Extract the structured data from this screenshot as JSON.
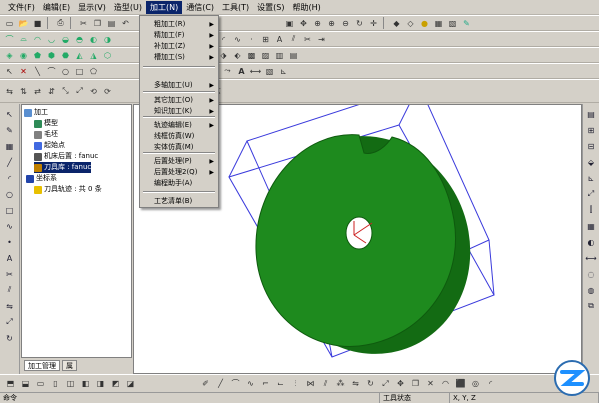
{
  "menubar": {
    "items": [
      {
        "label": "文件(F)"
      },
      {
        "label": "编辑(E)"
      },
      {
        "label": "显示(V)"
      },
      {
        "label": "造型(U)"
      },
      {
        "label": "加工(N)"
      },
      {
        "label": "通信(C)"
      },
      {
        "label": "工具(T)"
      },
      {
        "label": "设置(S)"
      },
      {
        "label": "帮助(H)"
      }
    ],
    "active_index": 4
  },
  "processing_menu": {
    "items": [
      {
        "label": "粗加工(R)",
        "submenu": true
      },
      {
        "label": "精加工(F)",
        "submenu": true
      },
      {
        "label": "补加工(Z)",
        "submenu": true
      },
      {
        "label": "槽加工(S)",
        "submenu": true
      },
      {
        "label": "多轴加工(U)",
        "submenu": true
      },
      {
        "label": "其它加工(O)",
        "submenu": true
      },
      {
        "label": "知识加工(K)",
        "submenu": true
      },
      {
        "label": "轨迹编辑(E)",
        "submenu": true
      },
      {
        "label": "线框仿真(W)",
        "submenu": false
      },
      {
        "label": "实体仿真(M)",
        "submenu": false
      },
      {
        "label": "后置处理(P)",
        "submenu": true
      },
      {
        "label": "后置处理2(Q)",
        "submenu": true
      },
      {
        "label": "编程助手(A)",
        "submenu": false
      },
      {
        "label": "工艺清单(B)",
        "submenu": false
      }
    ]
  },
  "tree": {
    "root": "加工",
    "nodes": [
      {
        "label": "模型",
        "icon": "model-icon",
        "color": "#2e8b57"
      },
      {
        "label": "毛坯",
        "icon": "blank-icon",
        "color": "#808080"
      },
      {
        "label": "起始点",
        "icon": "start-point-icon",
        "color": "#4169e1"
      },
      {
        "label": "机床后置 : fanuc",
        "icon": "machine-icon",
        "color": "#555555"
      },
      {
        "label": "刀具库 : fanuc",
        "icon": "tool-library-icon",
        "color": "#c08000",
        "selected": true
      },
      {
        "label": "坐标系",
        "icon": "coordinate-icon",
        "color": "#2244aa"
      },
      {
        "label": "刀具轨迹 : 共 0 条",
        "icon": "folder-icon",
        "color": "#e8c000"
      }
    ]
  },
  "panel_tabs": [
    {
      "label": "加工管理"
    },
    {
      "label": "属"
    }
  ],
  "status": {
    "command": "命令",
    "tool_status": "工具状态",
    "coords": "X, Y, Z"
  },
  "colors": {
    "part_green": "#1e8a1e",
    "menu_highlight": "#0a246a",
    "frame_blue": "#3a3adc"
  }
}
